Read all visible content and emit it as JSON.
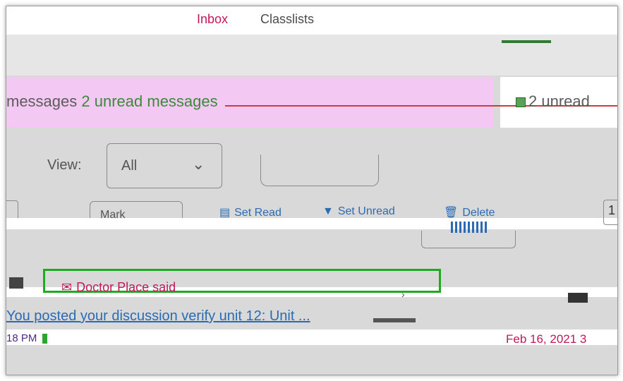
{
  "nav": {
    "items": [
      {
        "label": "Inbox"
      },
      {
        "label": "Classlists"
      }
    ]
  },
  "messages": {
    "left_text": "messages",
    "unread_text": "2 unread messages",
    "right_text": "2 unread"
  },
  "view": {
    "label": "View:",
    "selected": "All",
    "chevron": "⌄"
  },
  "toolbar": {
    "button_label": "Mark",
    "set_read": "Set Read",
    "set_unread": "Set Unread",
    "delete": "Delete",
    "page": "1"
  },
  "item": {
    "author": "Doctor Place said",
    "post_text": "You posted your discussion verify unit 12: Unit ...",
    "post_highlight": "",
    "time": "18 PM",
    "date": "Feb 16, 2021 3"
  },
  "colors": {
    "accent": "#c2185b",
    "link": "#2b6bb3",
    "focus": "#1faa1f",
    "banner": "#f3c9f3"
  }
}
